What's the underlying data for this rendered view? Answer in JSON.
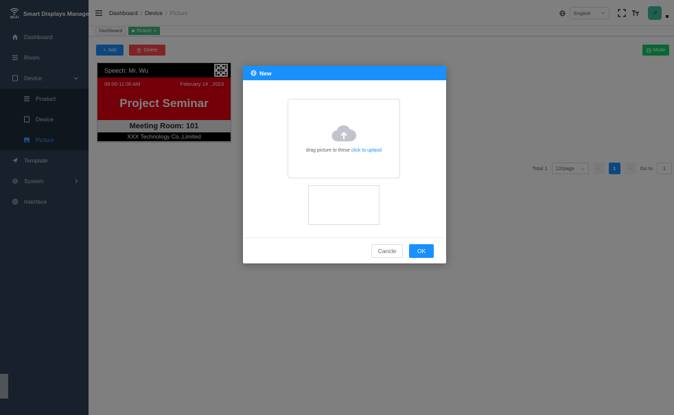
{
  "app": {
    "title": "Smart Displays Manager",
    "logo_text": "WI-FI"
  },
  "sidebar": {
    "items": [
      {
        "label": "Dashboard"
      },
      {
        "label": "Room"
      },
      {
        "label": "Device"
      },
      {
        "label": "Product"
      },
      {
        "label": "Device"
      },
      {
        "label": "Picture"
      },
      {
        "label": "Template"
      },
      {
        "label": "System"
      },
      {
        "label": "Interface"
      }
    ]
  },
  "header": {
    "breadcrumb": [
      "Dashboard",
      "Device",
      "Picture"
    ],
    "breadcrumb_sep": "/",
    "language": "English"
  },
  "tags": {
    "items": [
      {
        "label": "Dashboard"
      },
      {
        "label": "Picture"
      }
    ],
    "close": "×"
  },
  "toolbar": {
    "add_label": "Add",
    "add_icon": "+",
    "delete_label": "Delete",
    "mode_label": "Mode"
  },
  "card": {
    "speech": "Speech: Mr. Wu",
    "time": "09:00-11:00 AM",
    "date": "February 14 , 2023",
    "event": "Project Seminar",
    "room": "Meeting Room: 101",
    "company": "XXX Technology Co.,Limited"
  },
  "pagination": {
    "total": "Total 1",
    "page_size": "12/page",
    "current": "1",
    "goto_label": "Go to",
    "goto_value": "1",
    "prev": "<",
    "next": ">"
  },
  "dialog": {
    "title": "New",
    "upload_text": "drag picture to these",
    "upload_link": "click to uplaod",
    "cancel": "Cancle",
    "ok": "OK"
  },
  "colors": {
    "sidebar": "#304156",
    "primary": "#1890ff",
    "danger": "#ff4949",
    "success": "#13ce66",
    "tag_active": "#42b983",
    "card_red": "#e60012"
  }
}
